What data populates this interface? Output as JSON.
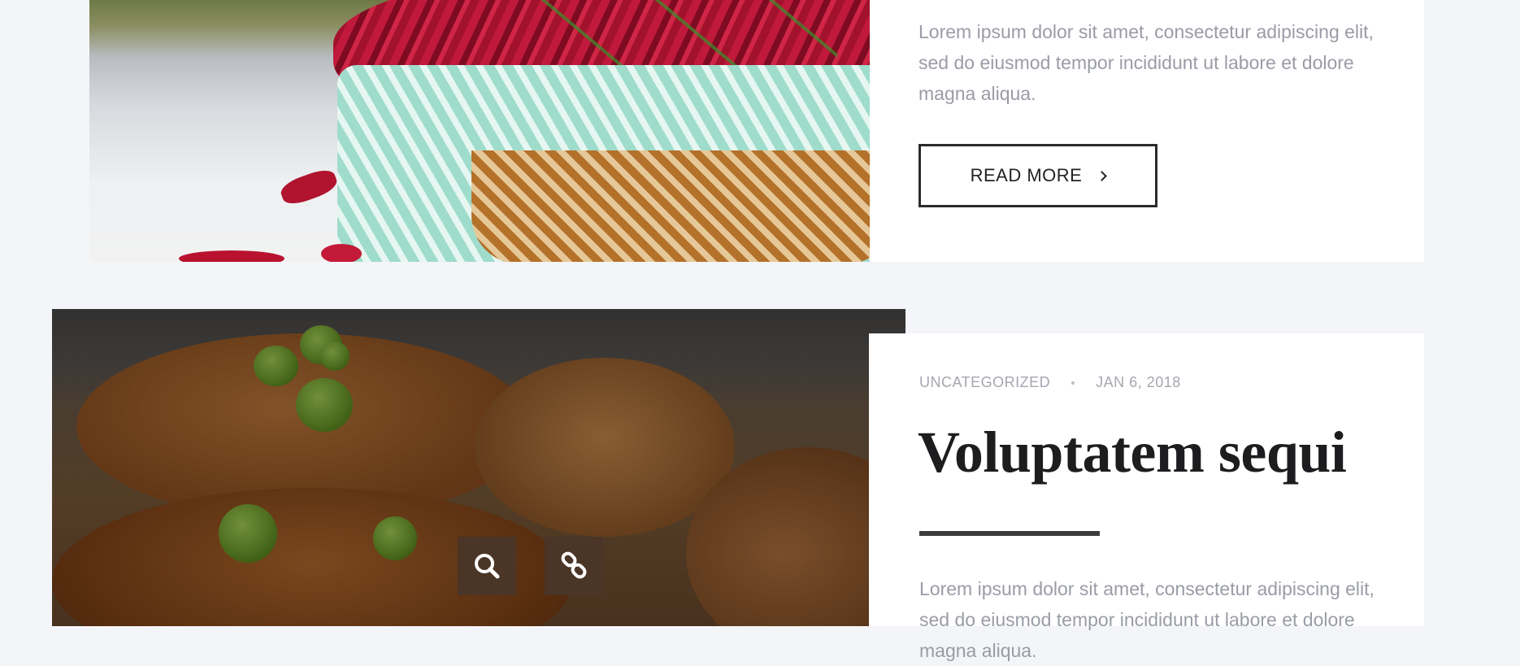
{
  "posts": [
    {
      "excerpt": "Lorem ipsum dolor sit amet, consectetur adipiscing elit, sed do eiusmod tempor incididunt ut labore et dolore magna aliqua.",
      "read_more_label": "READ MORE"
    },
    {
      "category": "UNCATEGORIZED",
      "date": "JAN 6, 2018",
      "title": "Voluptatem sequi",
      "excerpt": "Lorem ipsum dolor sit amet, consectetur adipiscing elit, sed do eiusmod tempor incididunt ut labore et dolore magna aliqua."
    }
  ],
  "icons": {
    "read_more": "chevron-right-icon",
    "zoom": "search-icon",
    "link": "link-icon"
  },
  "colors": {
    "page_background": "#f4f5f9",
    "card_background": "#ffffff",
    "text_muted": "#9a9ca6",
    "title": "#1d1d1f",
    "overlay_button": "#4a3527"
  }
}
